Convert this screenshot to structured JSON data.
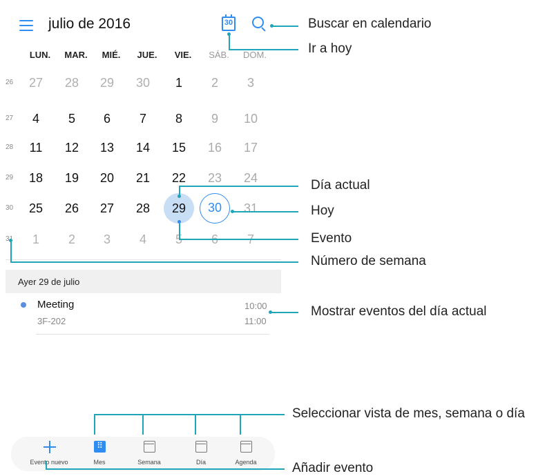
{
  "header": {
    "title": "julio de 2016",
    "today_icon_text": "30"
  },
  "weekdays": [
    "LUN.",
    "MAR.",
    "MIÉ.",
    "JUE.",
    "VIE.",
    "SÁB.",
    "DOM."
  ],
  "weeks": [
    {
      "num": "26",
      "days": [
        "27",
        "28",
        "29",
        "30",
        "1",
        "2",
        "3"
      ]
    },
    {
      "num": "27",
      "days": [
        "4",
        "5",
        "6",
        "7",
        "8",
        "9",
        "10"
      ]
    },
    {
      "num": "28",
      "days": [
        "11",
        "12",
        "13",
        "14",
        "15",
        "16",
        "17"
      ]
    },
    {
      "num": "29",
      "days": [
        "18",
        "19",
        "20",
        "21",
        "22",
        "23",
        "24"
      ]
    },
    {
      "num": "30",
      "days": [
        "25",
        "26",
        "27",
        "28",
        "29",
        "30",
        "31"
      ]
    },
    {
      "num": "31",
      "days": [
        "1",
        "2",
        "3",
        "4",
        "5",
        "6",
        "7"
      ]
    }
  ],
  "agenda": {
    "date_label": "Ayer  29 de julio",
    "events": [
      {
        "title": "Meeting",
        "location": "3F-202",
        "start": "10:00",
        "end": "11:00"
      }
    ]
  },
  "bottom_nav": {
    "new_event": "Evento nuevo",
    "month": "Mes",
    "week": "Semana",
    "day": "Día",
    "agenda": "Agenda"
  },
  "annotations": {
    "search": "Buscar en calendario",
    "go_today": "Ir a hoy",
    "current_day": "Día actual",
    "today": "Hoy",
    "event": "Evento",
    "week_number": "Número de semana",
    "show_events": "Mostrar eventos del día actual",
    "select_view": "Seleccionar vista de mes, semana o día",
    "add_event": "Añadir evento"
  },
  "colors": {
    "accent": "#2f8cf0",
    "callout": "#1fa5b8",
    "selected_bg": "#c7def5"
  }
}
